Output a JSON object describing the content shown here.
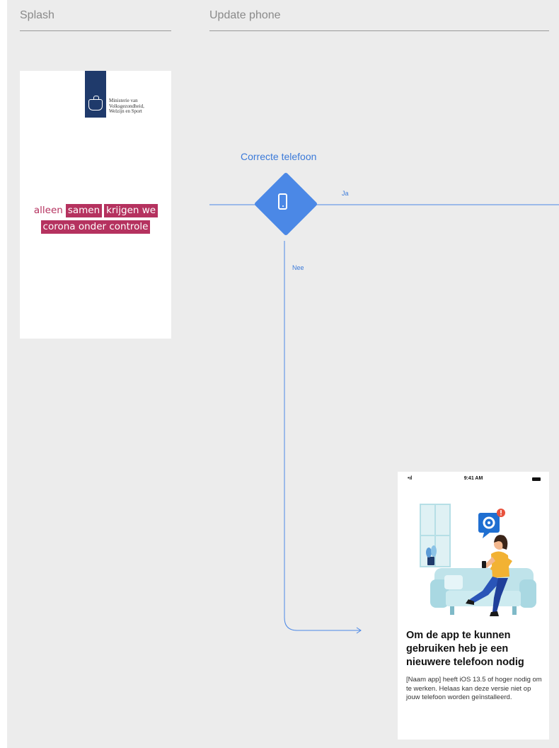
{
  "columns": [
    {
      "title": "Splash"
    },
    {
      "title": "Update phone"
    }
  ],
  "splash": {
    "ministry_name": [
      "Ministerie van",
      "Volksgezondheid,",
      "Welzijn en Sport"
    ],
    "slogan": {
      "line1": [
        "alleen",
        "samen",
        "krijgen we"
      ],
      "line2": "corona onder controle"
    }
  },
  "decision": {
    "title": "Correcte telefoon",
    "icon": "phone-icon",
    "yes_label": "Ja",
    "no_label": "Nee"
  },
  "phone_screen": {
    "status_time": "9:41 AM",
    "signal": "•ıl",
    "heading": "Om de app te kunnen gebruiken heb je een nieuwere telefoon nodig",
    "body": "[Naam app] heeft iOS 13.5 of hoger nodig om te werken. Helaas kan deze versie niet op jouw telefoon worden geïnstalleerd.",
    "illustration": "person-on-sofa-with-settings-notification"
  },
  "colors": {
    "flow_blue": "#4b88e6",
    "slogan_magenta": "#b5325f",
    "ministry_blue": "#1f3a6b"
  }
}
